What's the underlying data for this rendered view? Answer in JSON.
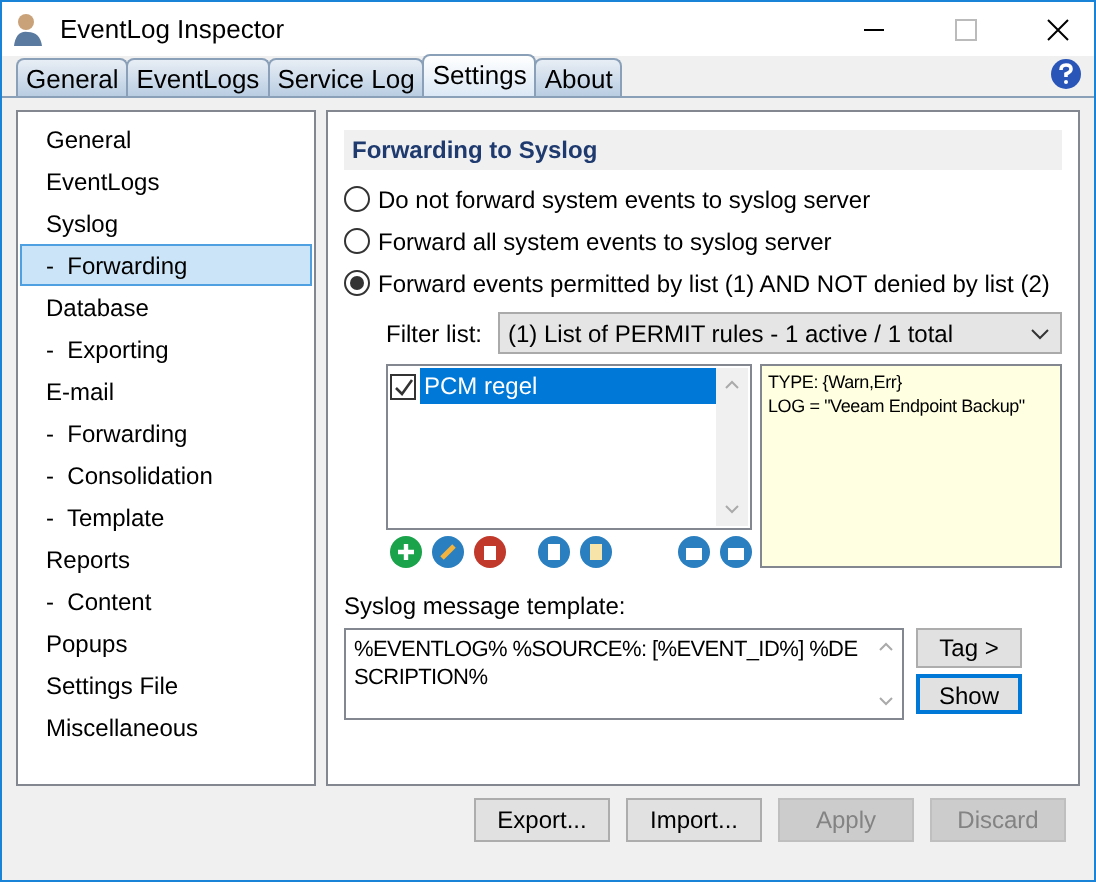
{
  "window": {
    "title": "EventLog Inspector"
  },
  "tabs": [
    {
      "label": "General",
      "selected": false
    },
    {
      "label": "EventLogs",
      "selected": false
    },
    {
      "label": "Service Log",
      "selected": false
    },
    {
      "label": "Settings",
      "selected": true
    },
    {
      "label": "About",
      "selected": false
    }
  ],
  "sidebar": {
    "items": [
      {
        "label": "General",
        "selected": false
      },
      {
        "label": "EventLogs",
        "selected": false
      },
      {
        "label": "Syslog",
        "selected": false,
        "children": [
          {
            "label": "-  Forwarding",
            "selected": true
          }
        ]
      },
      {
        "label": "Database",
        "selected": false,
        "children": [
          {
            "label": "-  Exporting",
            "selected": false
          }
        ]
      },
      {
        "label": "E-mail",
        "selected": false,
        "children": [
          {
            "label": "-  Forwarding",
            "selected": false
          },
          {
            "label": "-  Consolidation",
            "selected": false
          },
          {
            "label": "-  Template",
            "selected": false
          }
        ]
      },
      {
        "label": "Reports",
        "selected": false,
        "children": [
          {
            "label": "-  Content",
            "selected": false
          }
        ]
      },
      {
        "label": "Popups",
        "selected": false
      },
      {
        "label": "Settings File",
        "selected": false
      },
      {
        "label": "Miscellaneous",
        "selected": false
      }
    ]
  },
  "panel": {
    "title": "Forwarding to Syslog",
    "options": [
      {
        "label": "Do not forward system events to syslog server",
        "selected": false
      },
      {
        "label": "Forward all system events to syslog server",
        "selected": false
      },
      {
        "label": "Forward events permitted by list (1) AND NOT denied by list (2)",
        "selected": true
      }
    ],
    "filter_label": "Filter list:",
    "filter_value": "(1) List of PERMIT rules - 1 active / 1 total",
    "rules": [
      {
        "label": "PCM regel",
        "checked": true,
        "selected": true
      }
    ],
    "rule_details": [
      "TYPE: {Warn,Err}",
      "LOG = \"Veeam Endpoint Backup\""
    ],
    "template_label": "Syslog message template:",
    "template_value": "%EVENTLOG% %SOURCE%: [%EVENT_ID%] %DESCRIPTION%",
    "template_buttons": [
      {
        "label": "Tag >",
        "focused": false
      },
      {
        "label": "Show",
        "focused": true
      }
    ]
  },
  "buttons": [
    {
      "label": "Export...",
      "disabled": false
    },
    {
      "label": "Import...",
      "disabled": false
    },
    {
      "label": "Apply",
      "disabled": true
    },
    {
      "label": "Discard",
      "disabled": true
    }
  ]
}
